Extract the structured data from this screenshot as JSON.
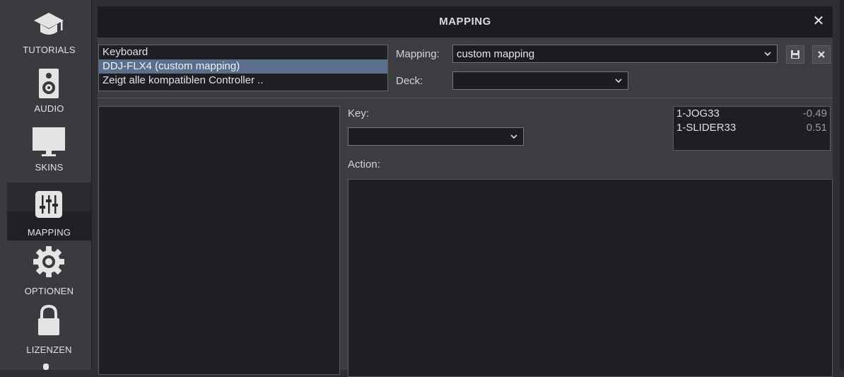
{
  "sidebar": {
    "items": [
      {
        "label": "TUTORIALS",
        "icon": "graduation-cap-icon"
      },
      {
        "label": "AUDIO",
        "icon": "speaker-icon"
      },
      {
        "label": "SKINS",
        "icon": "monitor-icon"
      },
      {
        "label": "MAPPING",
        "icon": "sliders-icon",
        "active": true
      },
      {
        "label": "OPTIONEN",
        "icon": "gear-icon"
      },
      {
        "label": "LIZENZEN",
        "icon": "lock-icon"
      }
    ]
  },
  "panel": {
    "title": "MAPPING",
    "close_glyph": "✕",
    "controllers": [
      "Keyboard",
      "DDJ-FLX4 (custom mapping)",
      "Zeigt alle kompatiblen Controller .."
    ],
    "selected_controller": 1,
    "mapping_label": "Mapping:",
    "mapping_value": "custom mapping",
    "deck_label": "Deck:",
    "deck_value": "",
    "key_label": "Key:",
    "key_value": "",
    "action_label": "Action:",
    "monitor": [
      {
        "name": "1-JOG33",
        "value": "-0.49"
      },
      {
        "name": "1-SLIDER33",
        "value": "0.51"
      }
    ]
  },
  "colors": {
    "accent_selected": "#5b6e8c",
    "background": "#2e2f33",
    "panel": "#3c3d41"
  }
}
